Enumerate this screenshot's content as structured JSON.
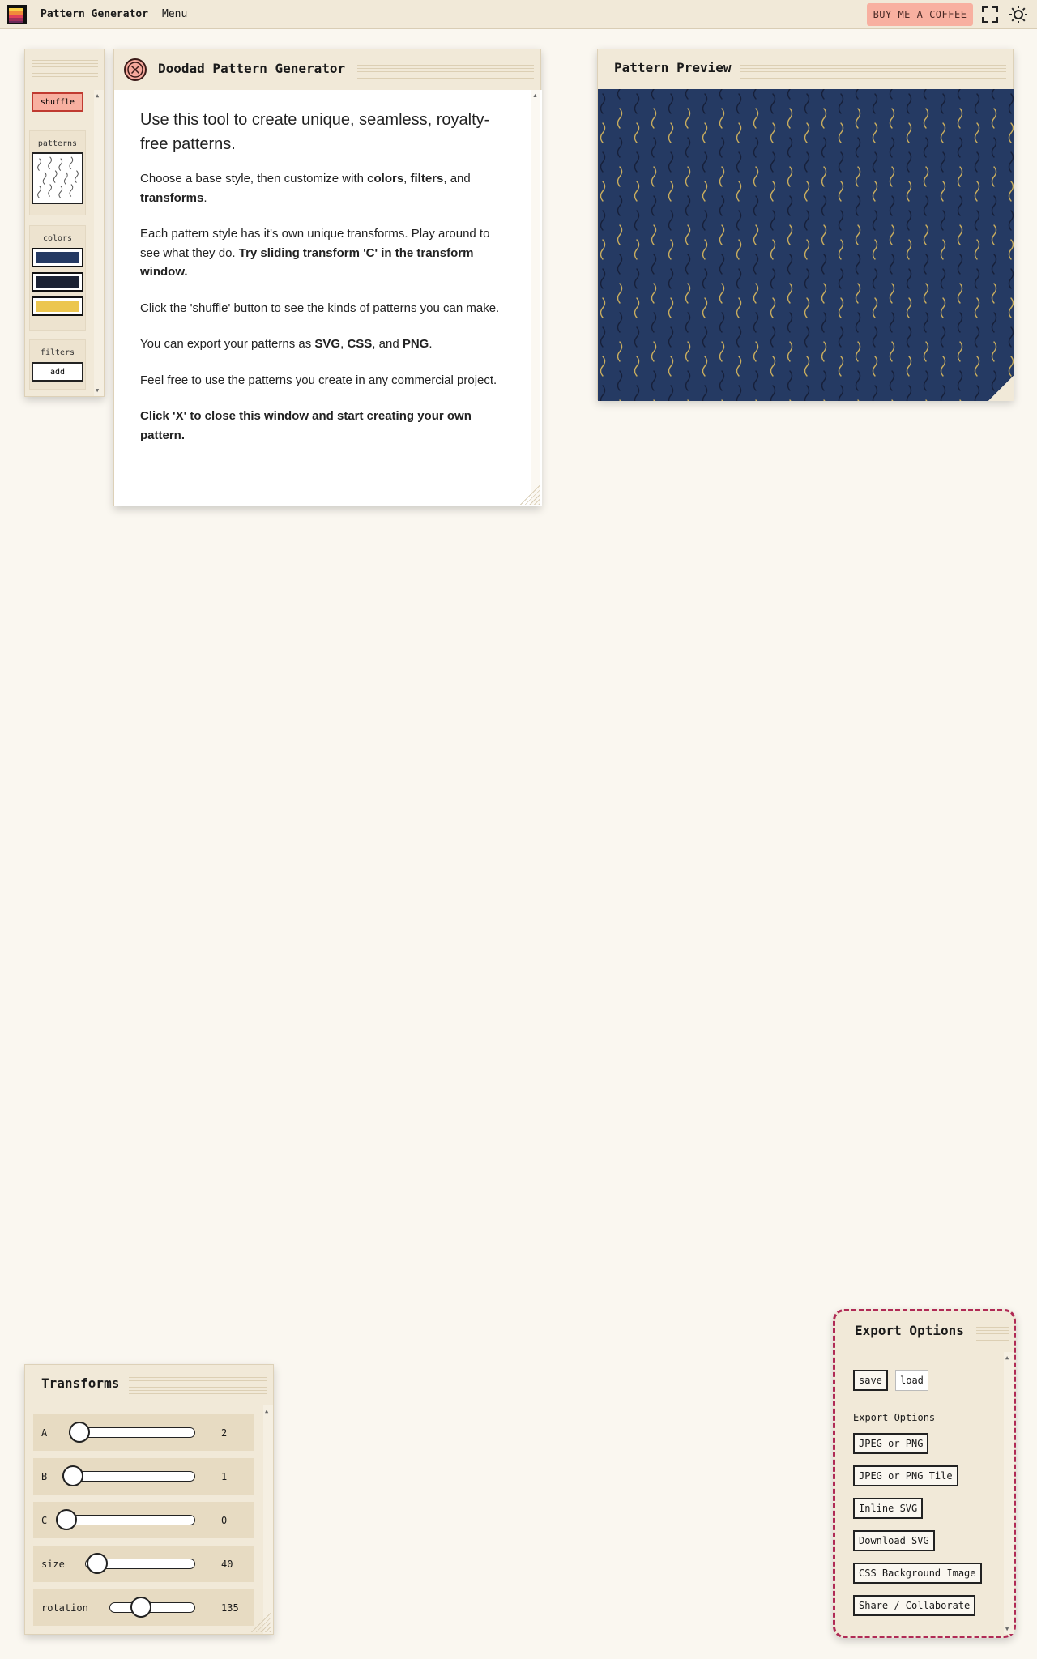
{
  "header": {
    "app_title": "Pattern Generator",
    "menu_label": "Menu",
    "coffee_label": "BUY ME A COFFEE"
  },
  "sidebar": {
    "shuffle_label": "shuffle",
    "patterns_label": "patterns",
    "colors_label": "colors",
    "filters_label": "filters",
    "add_label": "add",
    "colors": [
      "#253a63",
      "#1b2234",
      "#ecc64f"
    ]
  },
  "intro": {
    "title": "Doodad Pattern Generator",
    "lead": "Use this tool to create unique, seamless, royalty-free patterns.",
    "p1_pre": "Choose a base style, then customize with ",
    "p1_colors": "colors",
    "p1_sep1": ", ",
    "p1_filters": "filters",
    "p1_sep2": ", and ",
    "p1_transforms": "transforms",
    "p1_end": ".",
    "p2_pre": "Each pattern style has it's own unique transforms. Play around to see what they do. ",
    "p2_bold": "Try sliding transform 'C' in the transform window.",
    "p3": "Click the 'shuffle' button to see the kinds of patterns you can make.",
    "p4_pre": "You can export your patterns as ",
    "p4_svg": "SVG",
    "p4_sep1": ", ",
    "p4_css": "CSS",
    "p4_sep2": ", and ",
    "p4_png": "PNG",
    "p4_end": ".",
    "p5": "Feel free to use the patterns you create in any commercial project.",
    "p6": "Click 'X' to close this window and start creating your own pattern."
  },
  "preview": {
    "title": "Pattern Preview",
    "background": "#253a63",
    "dark_stroke": "#17203a",
    "light_stroke": "#c9ad5e"
  },
  "transforms": {
    "title": "Transforms",
    "rows": [
      {
        "label": "A",
        "value": "2"
      },
      {
        "label": "B",
        "value": "1"
      },
      {
        "label": "C",
        "value": "0"
      },
      {
        "label": "size",
        "value": "40"
      },
      {
        "label": "rotation",
        "value": "135"
      }
    ]
  },
  "export": {
    "title": "Export Options",
    "save_label": "save",
    "load_label": "load",
    "section_label": "Export Options",
    "buttons": [
      "JPEG or PNG",
      "JPEG or PNG Tile",
      "Inline SVG",
      "Download SVG",
      "CSS Background Image",
      "Share / Collaborate"
    ]
  }
}
